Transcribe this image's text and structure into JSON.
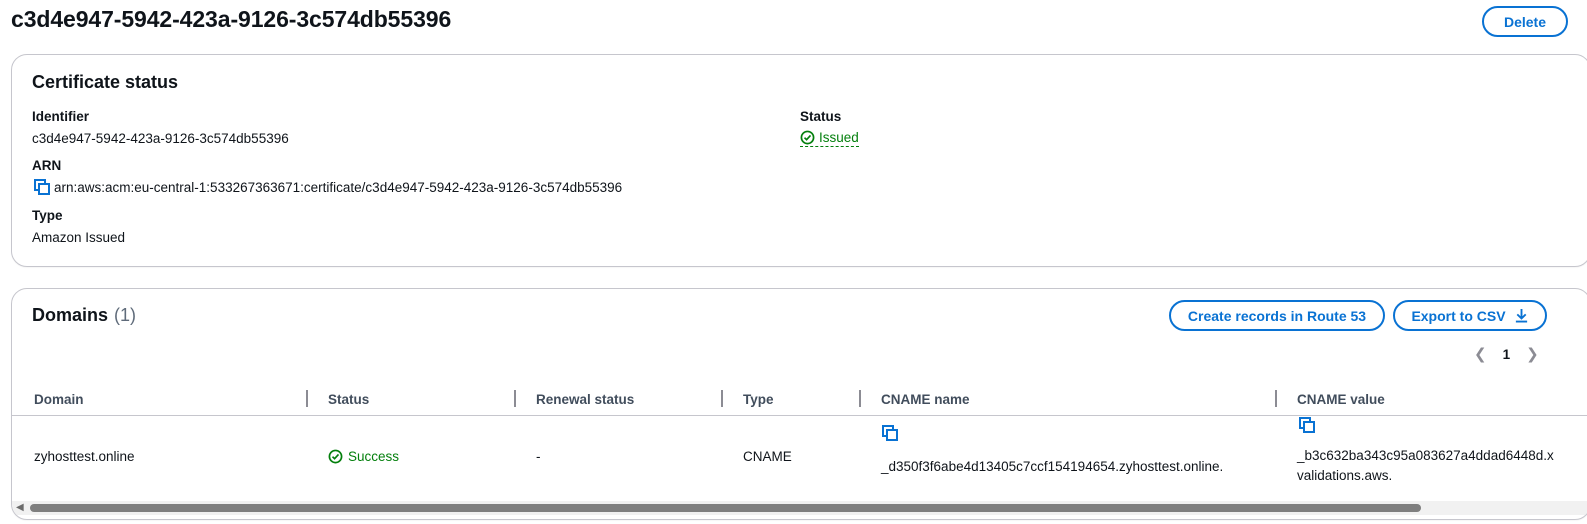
{
  "page": {
    "title": "c3d4e947-5942-423a-9126-3c574db55396",
    "delete_label": "Delete"
  },
  "status_card": {
    "title": "Certificate status",
    "identifier_label": "Identifier",
    "identifier_value": "c3d4e947-5942-423a-9126-3c574db55396",
    "arn_label": "ARN",
    "arn_value": "arn:aws:acm:eu-central-1:533267363671:certificate/c3d4e947-5942-423a-9126-3c574db55396",
    "type_label": "Type",
    "type_value": "Amazon Issued",
    "status_label": "Status",
    "status_value": "Issued"
  },
  "domains_card": {
    "title": "Domains",
    "count": "(1)",
    "create_records_label": "Create records in Route 53",
    "export_label": "Export to CSV",
    "pagination": {
      "current_page": "1"
    },
    "columns": [
      "Domain",
      "Status",
      "Renewal status",
      "Type",
      "CNAME name",
      "CNAME value"
    ],
    "rows": [
      {
        "domain": "zyhosttest.online",
        "status": "Success",
        "renewal_status": "-",
        "type": "CNAME",
        "cname_name": "_d350f3f6abe4d13405c7ccf154194654.zyhosttest.online.",
        "cname_value_line1": "_b3c632ba343c95a083627a4ddad6448d.x",
        "cname_value_line2": "validations.aws."
      }
    ]
  },
  "colors": {
    "accent": "#0972d3",
    "success": "#037f0c",
    "text": "#0f141a",
    "border": "#c6c6cd"
  },
  "icons": {
    "copy": "copy-icon",
    "check": "check-circle-icon",
    "download": "download-icon"
  }
}
